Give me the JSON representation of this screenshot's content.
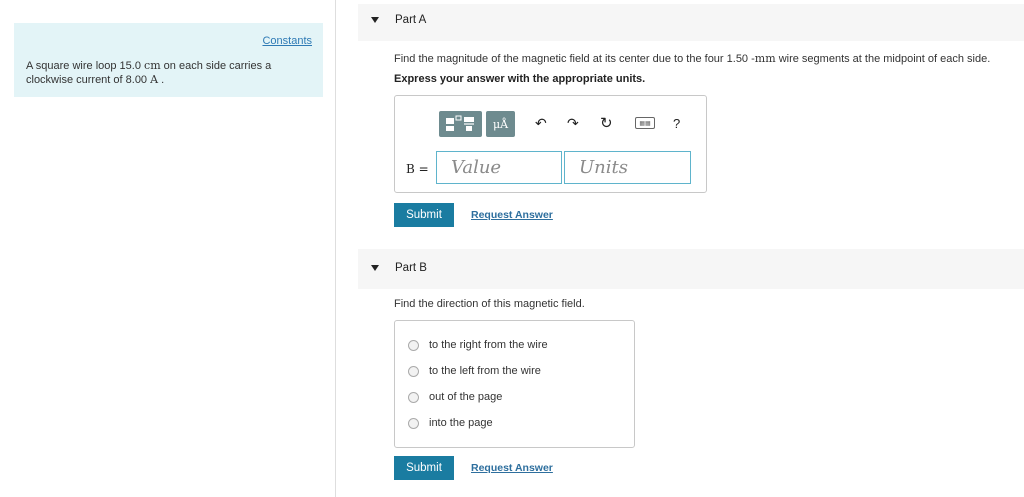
{
  "left_panel": {
    "constants_link": "Constants",
    "problem": {
      "t1": "A square wire loop 15.0 ",
      "u1": "cm",
      "t2": " on each side carries a clockwise current of 8.00 ",
      "u2": "A",
      "t3": " ."
    }
  },
  "part_a": {
    "title": "Part A",
    "question": {
      "t1": "Find the magnitude of the magnetic field at its center due to the four 1.50 -",
      "unit": "mm",
      "t2": " wire segments at the midpoint of each side."
    },
    "instruction": "Express your answer with the appropriate units.",
    "toolbar": {
      "mu_label": "μÅ",
      "undo": "↶",
      "redo": "↷",
      "reset": "↻",
      "help": "?"
    },
    "variable_label": "B =",
    "value_placeholder": "Value",
    "units_placeholder": "Units",
    "submit_label": "Submit",
    "request_label": "Request Answer"
  },
  "part_b": {
    "title": "Part B",
    "question": "Find the direction of this magnetic field.",
    "options": [
      "to the right from the wire",
      "to the left from the wire",
      "out of the page",
      "into the page"
    ],
    "submit_label": "Submit",
    "request_label": "Request Answer"
  },
  "colors": {
    "accent": "#1a7ca1",
    "panel_bg": "#e3f4f7",
    "toolbar_btn": "#6e8b8f"
  }
}
